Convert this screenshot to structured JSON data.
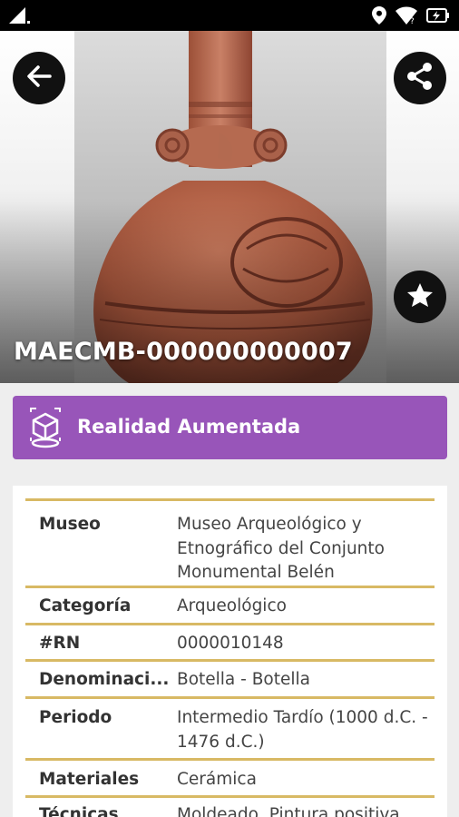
{
  "status_bar": {
    "icons": [
      "signal-icon",
      "location-icon",
      "wifi-icon",
      "battery-charging-icon"
    ]
  },
  "hero": {
    "code": "MAECMB-000000000007",
    "back_icon": "arrow-left-icon",
    "share_icon": "share-icon",
    "favorite_icon": "star-icon"
  },
  "ar_button": {
    "label": "Realidad Aumentada",
    "icon": "augmented-reality-icon"
  },
  "details": [
    {
      "label": "Museo",
      "value": "Museo Arqueológico y Etnográfico del Conjunto Monumental Belén"
    },
    {
      "label": "Categoría",
      "value": "Arqueológico"
    },
    {
      "label": "#RN",
      "value": "0000010148"
    },
    {
      "label": "Denominaci...",
      "value": "Botella - Botella"
    },
    {
      "label": "Periodo",
      "value": "Intermedio Tardío (1000 d.C. - 1476 d.C.)"
    },
    {
      "label": "Materiales",
      "value": "Cerámica"
    },
    {
      "label": "Técnicas",
      "value": "Moldeado, Pintura positiva"
    }
  ],
  "colors": {
    "accent": "#9855b9",
    "divider": "#d8b964",
    "button_bg": "#111111"
  }
}
